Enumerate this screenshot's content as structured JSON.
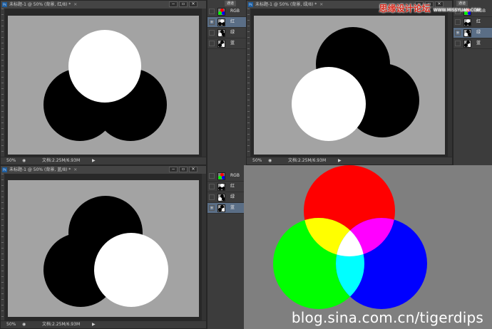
{
  "watermarks": {
    "site_cn": "思缘设计论坛",
    "site_url": "WWW.MISSYUAN.COM",
    "blog": "blog.sina.com.cn/tigerdips"
  },
  "windows": [
    {
      "title": "未标题-1 @ 50% (背景, 红/8) *",
      "zoom": "50%",
      "doc_info": "文档:2.25M/6.93M",
      "controls": [
        "−",
        "▫",
        "✕"
      ],
      "active_channel": "red"
    },
    {
      "title": "未标题-1 @ 50% (背景, 绿/8) *",
      "zoom": "50%",
      "doc_info": "文档:2.25M/6.93M",
      "controls": [
        "−",
        "▫",
        "✕"
      ],
      "active_channel": "green"
    },
    {
      "title": "未标题-1 @ 50% (背景, 蓝/8) *",
      "zoom": "50%",
      "doc_info": "文档:2.25M/6.93M",
      "controls": [
        "−",
        "▫",
        "✕"
      ],
      "active_channel": "blue"
    }
  ],
  "channel_panels": [
    {
      "tab": "通道",
      "channels": [
        {
          "label": "RGB",
          "visible": false,
          "selected": false
        },
        {
          "label": "红",
          "visible": true,
          "selected": true
        },
        {
          "label": "绿",
          "visible": false,
          "selected": false
        },
        {
          "label": "蓝",
          "visible": false,
          "selected": false
        }
      ]
    },
    {
      "tab": "通道",
      "channels": [
        {
          "label": "RGB",
          "visible": false,
          "selected": false
        },
        {
          "label": "红",
          "visible": false,
          "selected": false
        },
        {
          "label": "绿",
          "visible": true,
          "selected": true
        },
        {
          "label": "蓝",
          "visible": false,
          "selected": false
        }
      ]
    },
    {
      "tab": "通道",
      "channels": [
        {
          "label": "RGB",
          "visible": false,
          "selected": false
        },
        {
          "label": "红",
          "visible": false,
          "selected": false
        },
        {
          "label": "绿",
          "visible": false,
          "selected": false
        },
        {
          "label": "蓝",
          "visible": true,
          "selected": true
        }
      ]
    }
  ],
  "colors": {
    "red": "#ff0000",
    "green": "#00ff00",
    "blue": "#0000ff",
    "yellow": "#ffff00",
    "magenta": "#ff00ff",
    "cyan": "#00ffff",
    "white": "#ffffff",
    "black": "#000000",
    "channel_bg": "#a3a3a3",
    "composite_bg": "#7f7f7f"
  }
}
